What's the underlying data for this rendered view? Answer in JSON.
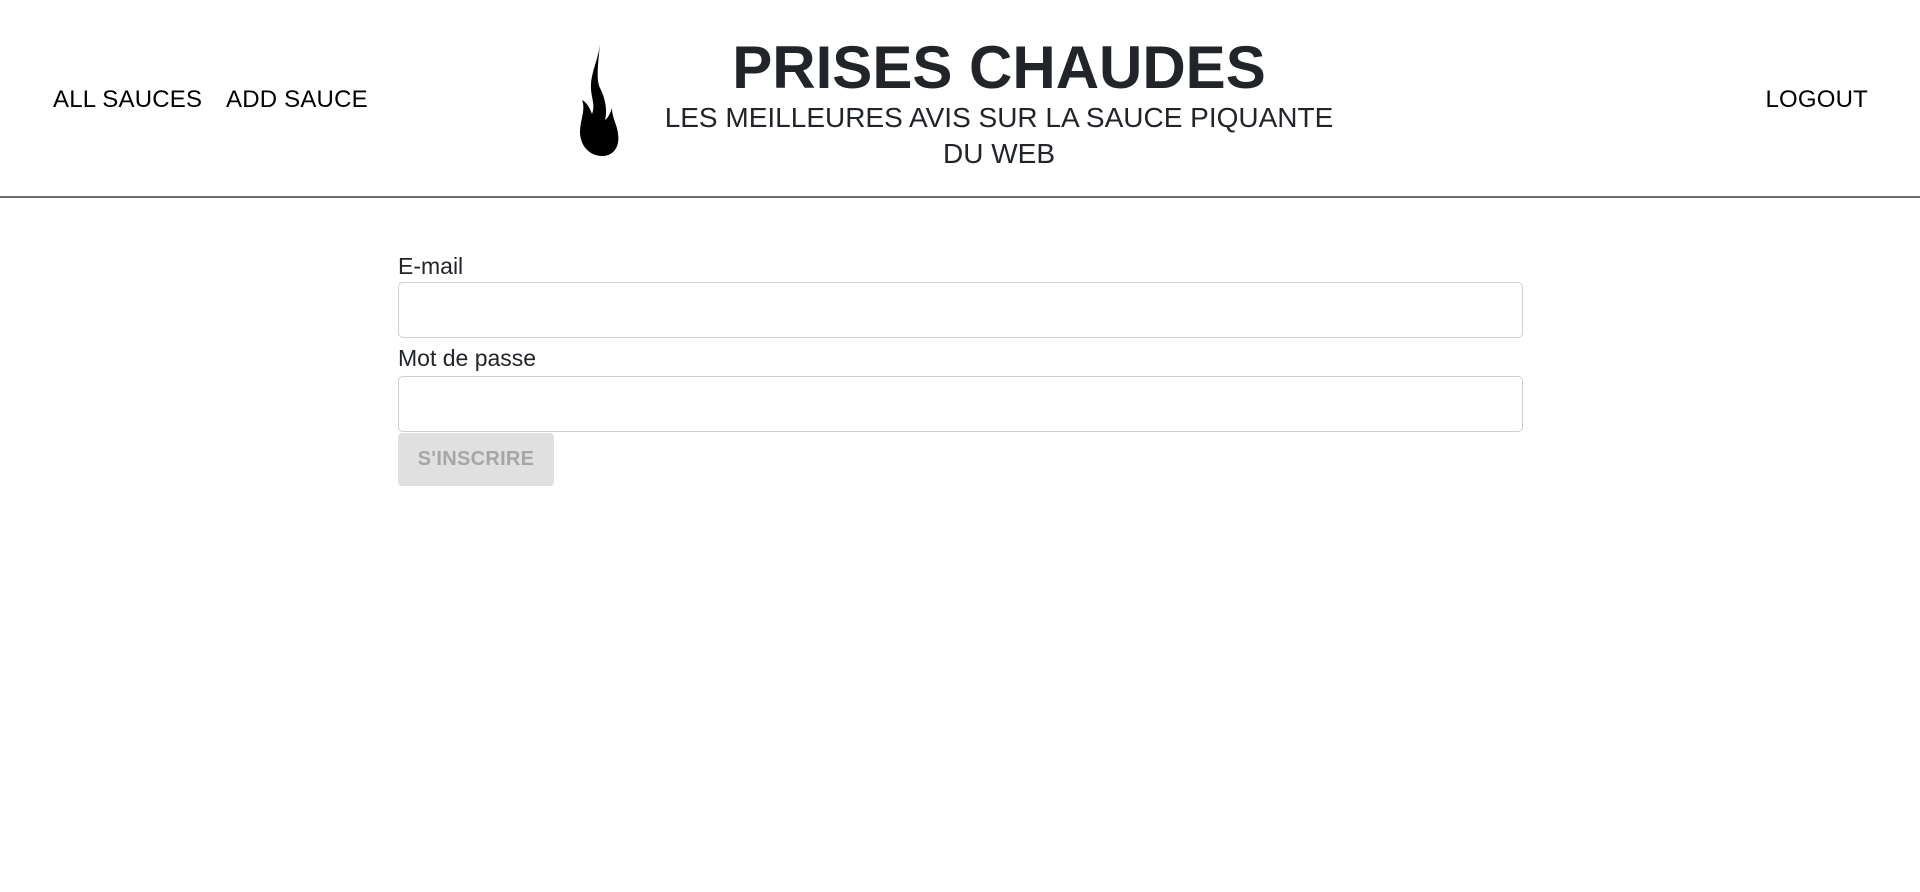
{
  "nav": {
    "all_sauces": "ALL SAUCES",
    "add_sauce": "ADD SAUCE",
    "logout": "LOGOUT"
  },
  "brand": {
    "icon": "flame-icon",
    "title": "PRISES CHAUDES",
    "subtitle": "LES MEILLEURES AVIS SUR LA SAUCE PIQUANTE DU WEB"
  },
  "form": {
    "email_label": "E-mail",
    "email_value": "",
    "password_label": "Mot de passe",
    "password_value": "",
    "submit_label": "S'INSCRIRE",
    "submit_disabled": true
  },
  "colors": {
    "text": "#212529",
    "header_border": "#6c6c6c",
    "button_disabled_bg": "#e0e0e0",
    "button_disabled_text": "#a6a6a6"
  }
}
